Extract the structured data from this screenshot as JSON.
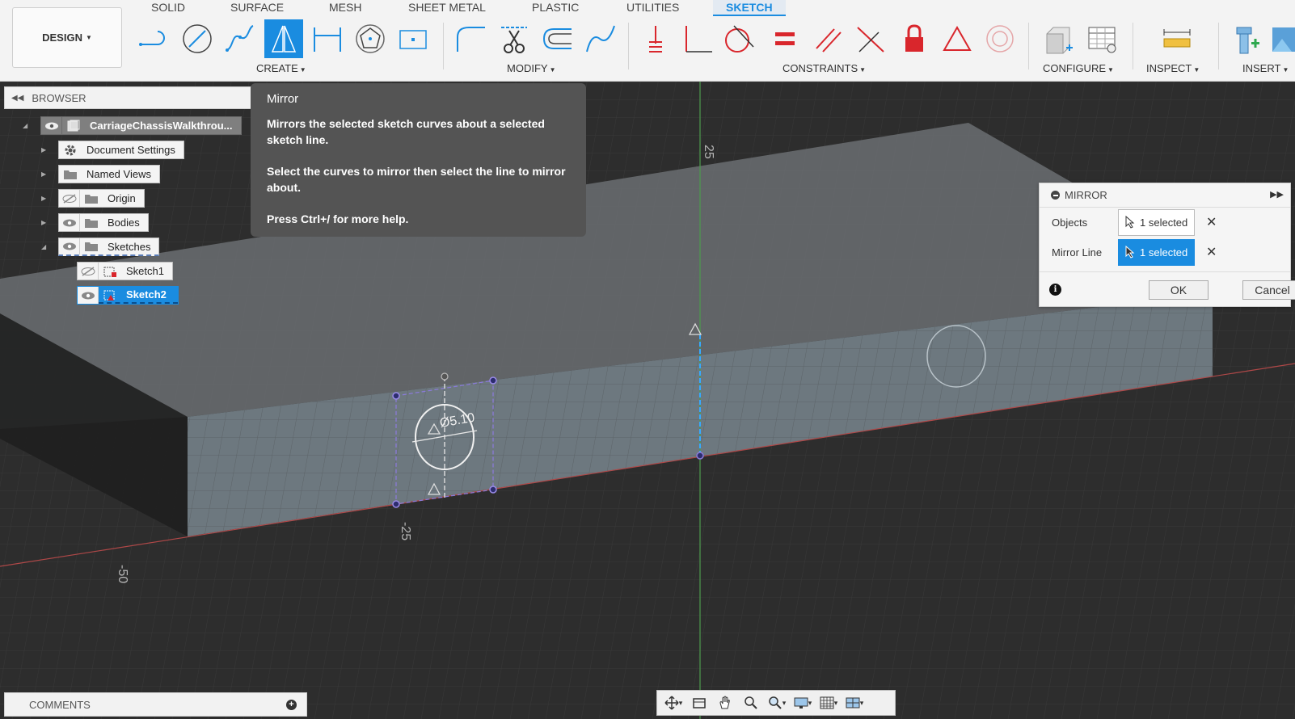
{
  "toolbar": {
    "workspace_button": "DESIGN",
    "tabs": [
      "SOLID",
      "SURFACE",
      "MESH",
      "SHEET METAL",
      "PLASTIC",
      "UTILITIES",
      "SKETCH"
    ],
    "active_tab": "SKETCH",
    "groups": {
      "create": "CREATE",
      "modify": "MODIFY",
      "constraints": "CONSTRAINTS",
      "configure": "CONFIGURE",
      "inspect": "INSPECT",
      "insert": "INSERT"
    },
    "create_tools": [
      "line-tool-icon",
      "circle-tool-icon",
      "spline-tool-icon",
      "mirror-tool-icon",
      "dimension-tool-icon",
      "polygon-tool-icon",
      "rectangle-tool-icon"
    ],
    "modify_tools": [
      "fillet-tool-icon",
      "trim-tool-icon",
      "offset-tool-icon",
      "extend-curve-tool-icon"
    ],
    "constraint_tools": [
      "coincident-constraint-icon",
      "perpendicular-constraint-icon",
      "tangent-constraint-icon",
      "equal-constraint-icon",
      "parallel-constraint-icon",
      "midpoint-constraint-icon",
      "fix-constraint-icon",
      "symmetry-constraint-icon",
      "concentric-constraint-icon"
    ]
  },
  "browser": {
    "title": "BROWSER",
    "root": "CarriageChassisWalkthrou...",
    "items": [
      {
        "label": "Document Settings"
      },
      {
        "label": "Named Views"
      },
      {
        "label": "Origin"
      },
      {
        "label": "Bodies"
      },
      {
        "label": "Sketches"
      },
      {
        "label": "Sketch1"
      },
      {
        "label": "Sketch2"
      }
    ]
  },
  "tooltip": {
    "title": "Mirror",
    "line1": "Mirrors the selected sketch curves about a selected sketch line.",
    "line2": "Select the curves to mirror then select the line to mirror about.",
    "line3": "Press Ctrl+/ for more help."
  },
  "mirror_dialog": {
    "title": "MIRROR",
    "objects_label": "Objects",
    "objects_value": "1 selected",
    "mirror_line_label": "Mirror Line",
    "mirror_line_value": "1 selected",
    "ok": "OK",
    "cancel": "Cancel"
  },
  "viewport": {
    "label_25_top": "25",
    "label_25_bottom": "-25",
    "label_50": "-50",
    "dimension": "Ø5.10"
  },
  "comments": {
    "title": "COMMENTS"
  },
  "colors": {
    "accent": "#1a8ce0",
    "constraint_red": "#d9262c"
  }
}
